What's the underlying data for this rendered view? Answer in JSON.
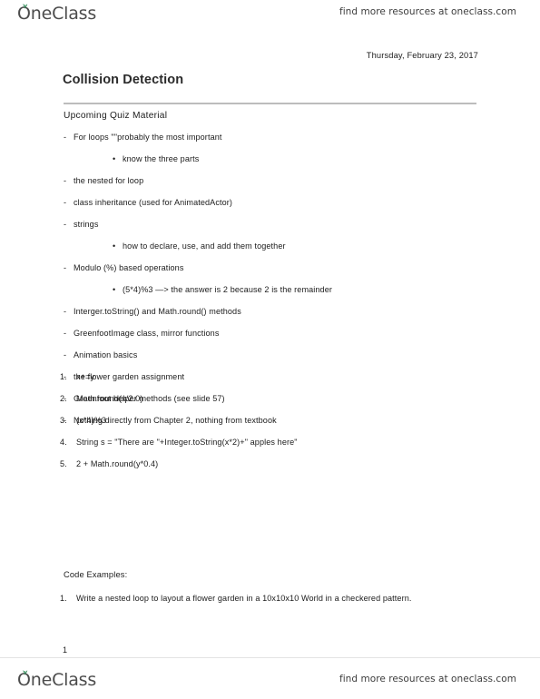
{
  "brand": {
    "wordmark": "OneClass",
    "leaf_color": "#2e8b57",
    "wordmark_color": "#4c4c4c",
    "logo_icon": "sprout-leaf-icon"
  },
  "header": {
    "promo_text": "find more resources at oneclass.com"
  },
  "footer": {
    "promo_text": "find more resources at oneclass.com"
  },
  "document": {
    "date": "Thursday, February 23, 2017",
    "title": "Collision Detection",
    "section_heading": "Upcoming Quiz Material",
    "page_number": "1",
    "rule_color": "#bcbcbc"
  },
  "outline": [
    {
      "level": 1,
      "marker": "-",
      "text": "For loops \"\"probably the most important"
    },
    {
      "level": 2,
      "marker": "•",
      "text": "know the three parts"
    },
    {
      "level": 1,
      "marker": "-",
      "text": "the nested for loop"
    },
    {
      "level": 1,
      "marker": "-",
      "text": "class inheritance (used for AnimatedActor)"
    },
    {
      "level": 1,
      "marker": "-",
      "text": "strings"
    },
    {
      "level": 2,
      "marker": "•",
      "text": "how to declare, use, and add them together"
    },
    {
      "level": 1,
      "marker": "-",
      "text": "Modulo (%) based operations"
    },
    {
      "level": 2,
      "marker": "•",
      "text": "(5*4)%3 —> the answer is 2 because 2 is the remainder"
    },
    {
      "level": 1,
      "marker": "-",
      "text": "Interger.toString() and Math.round() methods"
    },
    {
      "level": 1,
      "marker": "-",
      "text": "GreenfootImage class, mirror functions"
    },
    {
      "level": 1,
      "marker": "-",
      "text": "Animation basics"
    },
    {
      "level": 1,
      "marker": "-",
      "text": "the flower garden assignment"
    },
    {
      "level": 1,
      "marker": "-",
      "text": "Greenfoot helper methods (see slide 57)"
    },
    {
      "level": 1,
      "marker": "-",
      "text": "Nothing directly from Chapter 2, nothing from textbook"
    }
  ],
  "numbered_list": [
    {
      "marker": "1.",
      "text": "x+=y"
    },
    {
      "marker": "2.",
      "text": "Math.round(x/2.0)"
    },
    {
      "marker": "3.",
      "text": "(x*4)%3"
    },
    {
      "marker": "4.",
      "text": "String s = \"There are \"+Integer.toString(x*2)+\" apples here\""
    },
    {
      "marker": "5.",
      "text": "2 + Math.round(y*0.4)"
    }
  ],
  "code_examples": {
    "heading": "Code Examples:",
    "items": [
      {
        "marker": "1.",
        "text": "Write a nested loop to layout a flower garden  in a 10x10x10 World in a checkered pattern."
      }
    ]
  }
}
